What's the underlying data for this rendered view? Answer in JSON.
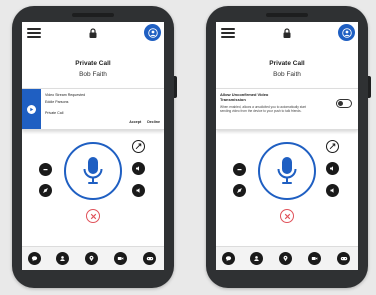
{
  "phones": [
    {
      "header": {
        "title": "Private Call",
        "name": "Bob Faith"
      },
      "notification": {
        "line1": "Video Stream Requested",
        "line2": "Eddie Parsons",
        "line3": "Private Call",
        "accept": "Accept",
        "decline": "Decline"
      }
    },
    {
      "header": {
        "title": "Private Call",
        "name": "Bob Faith"
      },
      "notification": {
        "title": "Allow Unconfirmed Video Transmission",
        "description": "When enabled, allows a unsolicited you to automatically start sending video from the device to your push to talk friends.",
        "toggle_on": false
      }
    }
  ],
  "icons": {
    "menu": "hamburger-icon",
    "lock": "lock-icon",
    "user": "user-icon",
    "mic": "microphone-icon",
    "end": "end-call-icon",
    "nav": [
      "chat-icon",
      "contacts-icon",
      "location-icon",
      "video-icon",
      "gamepad-icon"
    ]
  },
  "colors": {
    "accent": "#1f5fc2",
    "end_call": "#e0525a",
    "frame": "#2f3133"
  }
}
